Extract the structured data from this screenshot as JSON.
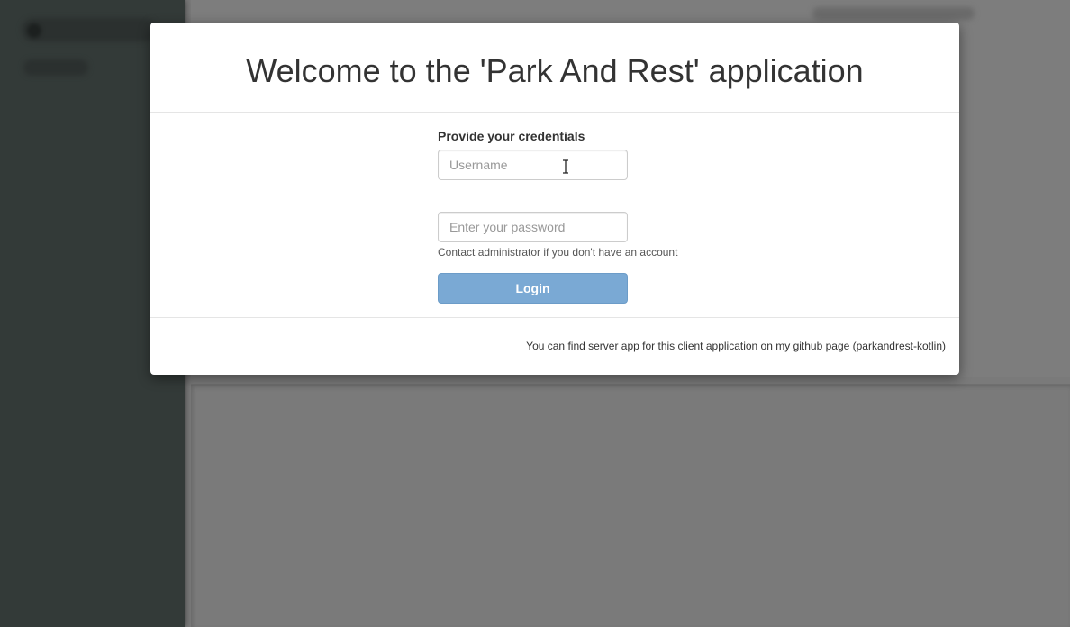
{
  "modal": {
    "title": "Welcome to the 'Park And Rest' application",
    "form": {
      "label": "Provide your credentials",
      "username_placeholder": "Username",
      "password_placeholder": "Enter your password",
      "help_text": "Contact administrator if you don't have an account",
      "login_label": "Login",
      "login_color": "#7aa9d4"
    },
    "footer_text": "You can find server app for this client application on my github page (parkandrest-kotlin)"
  },
  "colors": {
    "sidebar": "#333a38",
    "overlay_bg": "#7a7a7a"
  },
  "cursor": "text-cursor-icon"
}
